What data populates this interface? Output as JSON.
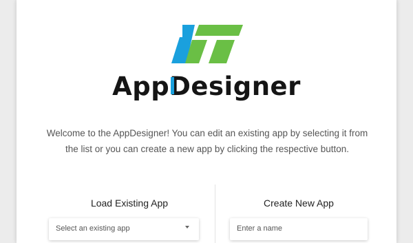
{
  "brand": {
    "prefix": "App",
    "accent_letter": "D",
    "suffix": "esigner",
    "colors": {
      "blue": "#1aa0dd",
      "green": "#6abf45",
      "text": "#151515"
    }
  },
  "welcome": {
    "text": "Welcome to the AppDesigner! You can edit an existing app by selecting it from the list or you can create a new app by clicking the respective button."
  },
  "load_section": {
    "title": "Load Existing App",
    "select_placeholder": "Select an existing app"
  },
  "create_section": {
    "title": "Create New App",
    "name_placeholder": "Enter a name"
  }
}
